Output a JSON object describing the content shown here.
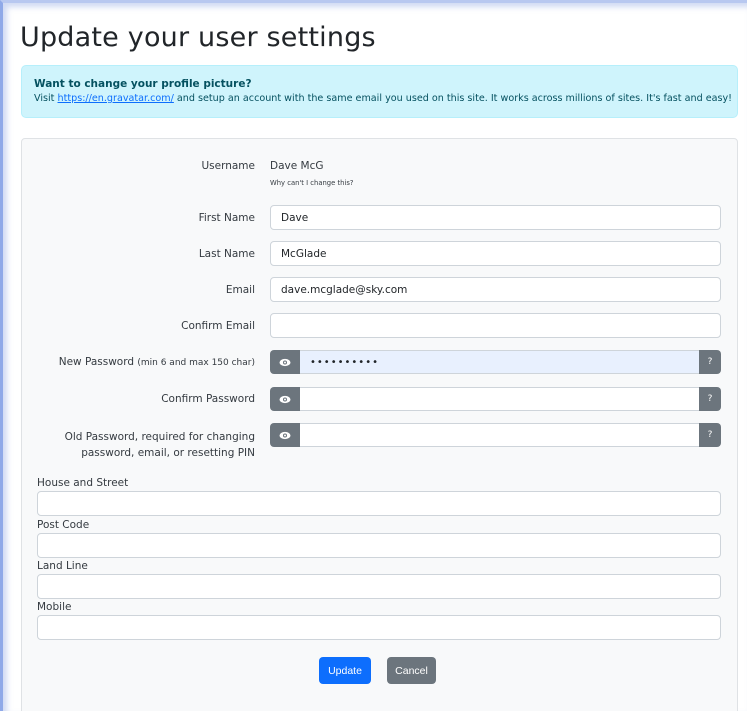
{
  "page": {
    "title": "Update your user settings"
  },
  "alert": {
    "heading": "Want to change your profile picture?",
    "text_before": "Visit ",
    "link": "https://en.gravatar.com/",
    "text_after": " and setup an account with the same email you used on this site. It works across millions of sites. It's fast and easy!"
  },
  "form": {
    "username": {
      "label": "Username",
      "value": "Dave McG",
      "hint": "Why can't I change this?"
    },
    "first_name": {
      "label": "First Name",
      "value": "Dave"
    },
    "last_name": {
      "label": "Last Name",
      "value": "McGlade"
    },
    "email": {
      "label": "Email",
      "value": "dave.mcglade@sky.com"
    },
    "confirm_email": {
      "label": "Confirm Email",
      "value": ""
    },
    "new_password": {
      "label": "New Password",
      "label_small": "(min 6 and max 150 char)",
      "value": "••••••••••",
      "help": "?"
    },
    "confirm_password": {
      "label": "Confirm Password",
      "value": "",
      "help": "?"
    },
    "old_password": {
      "label_line1": "Old Password, required for changing",
      "label_line2": "password, email, or resetting PIN",
      "value": "",
      "help": "?"
    },
    "house_street": {
      "label": "House and Street",
      "value": ""
    },
    "post_code": {
      "label": "Post Code",
      "value": ""
    },
    "land_line": {
      "label": "Land Line",
      "value": ""
    },
    "mobile": {
      "label": "Mobile",
      "value": ""
    }
  },
  "buttons": {
    "update": "Update",
    "cancel": "Cancel"
  },
  "icons": {
    "eye": "eye-icon"
  },
  "colors": {
    "primary": "#0d6efd",
    "secondary": "#6c757d",
    "alert_bg": "#cff4fc",
    "alert_text": "#055160",
    "autofill_bg": "#e8f0fe"
  }
}
